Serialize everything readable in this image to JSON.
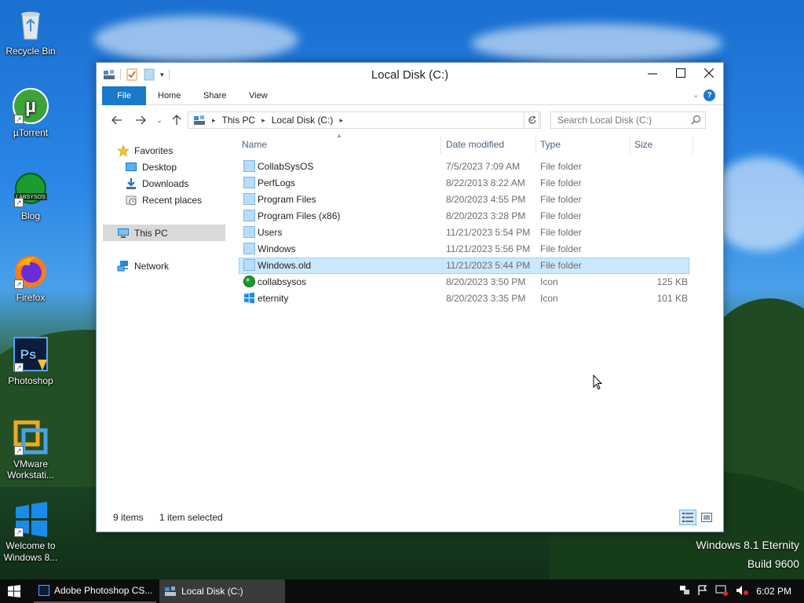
{
  "desktop": {
    "icons": [
      {
        "label": "Recycle Bin",
        "icon": "recycle-bin-icon"
      },
      {
        "label": "µTorrent",
        "icon": "utorrent-icon"
      },
      {
        "label": "Blog",
        "icon": "blog-icon",
        "badge": "LABSYSOS"
      },
      {
        "label": "Firefox",
        "icon": "firefox-icon"
      },
      {
        "label": "Photoshop",
        "icon": "photoshop-icon",
        "badge": "Ps"
      },
      {
        "label": "VMware Workstati...",
        "icon": "vmware-icon"
      },
      {
        "label": "Welcome to Windows 8...",
        "icon": "windows-logo-icon"
      }
    ],
    "watermark": {
      "line1": "Windows 8.1 Eternity",
      "line2": "Build 9600"
    }
  },
  "window": {
    "title": "Local Disk (C:)",
    "ribbon_tabs": {
      "file": "File",
      "home": "Home",
      "share": "Share",
      "view": "View"
    },
    "address": {
      "this_pc": "This PC",
      "local_disk": "Local Disk (C:)"
    },
    "search": {
      "placeholder": "Search Local Disk (C:)"
    },
    "nav": {
      "favorites": "Favorites",
      "desktop": "Desktop",
      "downloads": "Downloads",
      "recent": "Recent places",
      "this_pc": "This PC",
      "network": "Network"
    },
    "columns": {
      "name": "Name",
      "date": "Date modified",
      "type": "Type",
      "size": "Size"
    },
    "files": [
      {
        "name": "CollabSysOS",
        "date": "7/5/2023 7:09 AM",
        "type": "File folder",
        "size": ""
      },
      {
        "name": "PerfLogs",
        "date": "8/22/2013 8:22 AM",
        "type": "File folder",
        "size": ""
      },
      {
        "name": "Program Files",
        "date": "8/20/2023 4:55 PM",
        "type": "File folder",
        "size": ""
      },
      {
        "name": "Program Files (x86)",
        "date": "8/20/2023 3:28 PM",
        "type": "File folder",
        "size": ""
      },
      {
        "name": "Users",
        "date": "11/21/2023 5:54 PM",
        "type": "File folder",
        "size": ""
      },
      {
        "name": "Windows",
        "date": "11/21/2023 5:56 PM",
        "type": "File folder",
        "size": ""
      },
      {
        "name": "Windows.old",
        "date": "11/21/2023 5:44 PM",
        "type": "File folder",
        "size": ""
      },
      {
        "name": "collabsysos",
        "date": "8/20/2023 3:50 PM",
        "type": "Icon",
        "size": "125 KB"
      },
      {
        "name": "eternity",
        "date": "8/20/2023 3:35 PM",
        "type": "Icon",
        "size": "101 KB"
      }
    ],
    "status": {
      "count": "9 items",
      "selected": "1 item selected"
    }
  },
  "taskbar": {
    "photoshop": "Adobe Photoshop CS...",
    "explorer": "Local Disk (C:)",
    "clock": "6:02 PM"
  }
}
